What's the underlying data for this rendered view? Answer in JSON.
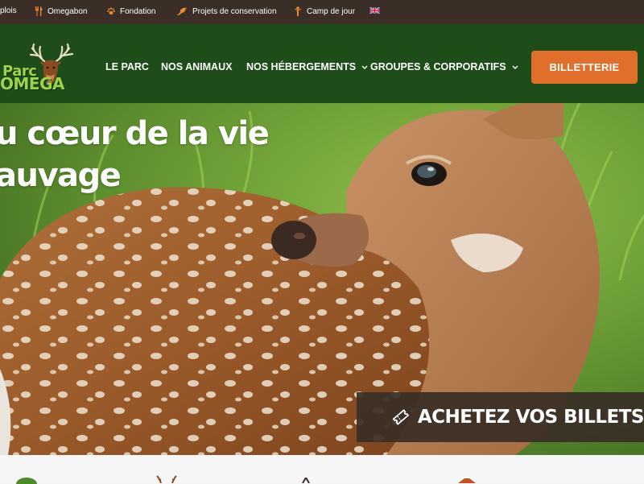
{
  "topbar": {
    "items": [
      {
        "label": "plois",
        "icon": "none"
      },
      {
        "label": "Omegabon",
        "icon": "fork-knife-icon"
      },
      {
        "label": "Fondation",
        "icon": "paw-icon"
      },
      {
        "label": "Projets de conservation",
        "icon": "bird-icon"
      },
      {
        "label": "Camp de jour",
        "icon": "child-icon"
      }
    ],
    "language_flag": "uk-flag-icon"
  },
  "header": {
    "logo_line1": "Parc",
    "logo_line2": "OMEGA",
    "nav": [
      {
        "label": "LE PARC",
        "has_dropdown": false
      },
      {
        "label": "NOS ANIMAUX",
        "has_dropdown": false
      },
      {
        "label": "NOS HÉBERGEMENTS",
        "has_dropdown": true
      },
      {
        "label": "GROUPES & CORPORATIFS",
        "has_dropdown": true
      }
    ],
    "ticket_button": "BILLETTERIE"
  },
  "hero": {
    "title_line1": "u cœur de la vie",
    "title_line2": "auvage",
    "cta_label": "ACHETEZ VOS BILLETS"
  },
  "colors": {
    "topbar_bg": "#3a2e27",
    "header_bg": "#1e4d1a",
    "accent_orange": "#e06f2c",
    "logo_green": "#9fd24b"
  }
}
